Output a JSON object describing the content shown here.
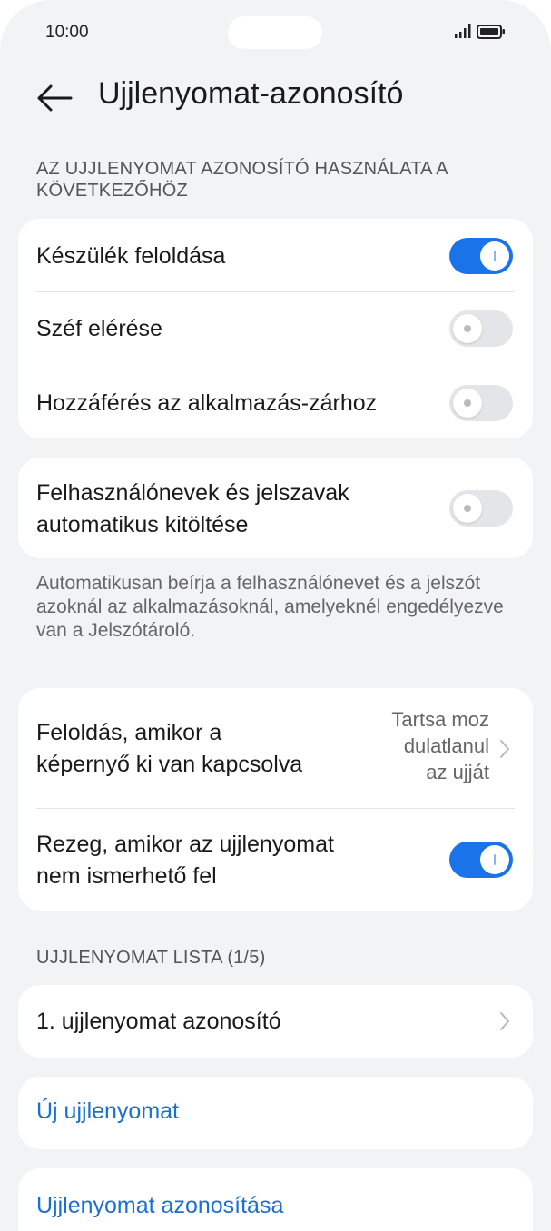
{
  "status_bar": {
    "time": "10:00"
  },
  "header": {
    "title": "Ujjlenyomat-azonosító"
  },
  "usage_section": {
    "header": "AZ UJJLENYOMAT AZONOSÍTÓ HASZNÁLATA A KÖVETKEZŐHÖZ",
    "items": [
      {
        "label": "Készülék feloldása",
        "enabled": true
      },
      {
        "label": "Széf elérése",
        "enabled": false
      },
      {
        "label": "Hozzáférés az alkalmazás-zárhoz",
        "enabled": false
      }
    ]
  },
  "autofill": {
    "label_line1": "Felhasználónevek és jelszavak",
    "label_line2": "automatikus kitöltése",
    "enabled": false,
    "note": "Automatikusan beírja a felhasználónevet és a jelszót azoknál az alkalmazásoknál, amelyeknél engedélyezve van a Jelszótároló."
  },
  "screen_off": {
    "label_line1": "Feloldás, amikor a",
    "label_line2": "képernyő ki van kapcsolva",
    "value_line1": "Tartsa moz",
    "value_line2": "dulatlanul",
    "value_line3": "az ujját"
  },
  "vibrate": {
    "label_line1": "Rezeg, amikor az ujjlenyomat",
    "label_line2": "nem ismerhető fel",
    "enabled": true
  },
  "fingerprint_list": {
    "header": "UJJLENYOMAT LISTA (1/5)",
    "items": [
      {
        "label": "1. ujjlenyomat azonosító"
      }
    ]
  },
  "actions": {
    "new_fingerprint": "Új ujjlenyomat",
    "identify_fingerprint": "Ujjlenyomat azonosítása"
  },
  "colors": {
    "accent": "#1a73e8",
    "link": "#1a6fd6",
    "background": "#f1f3f5"
  }
}
